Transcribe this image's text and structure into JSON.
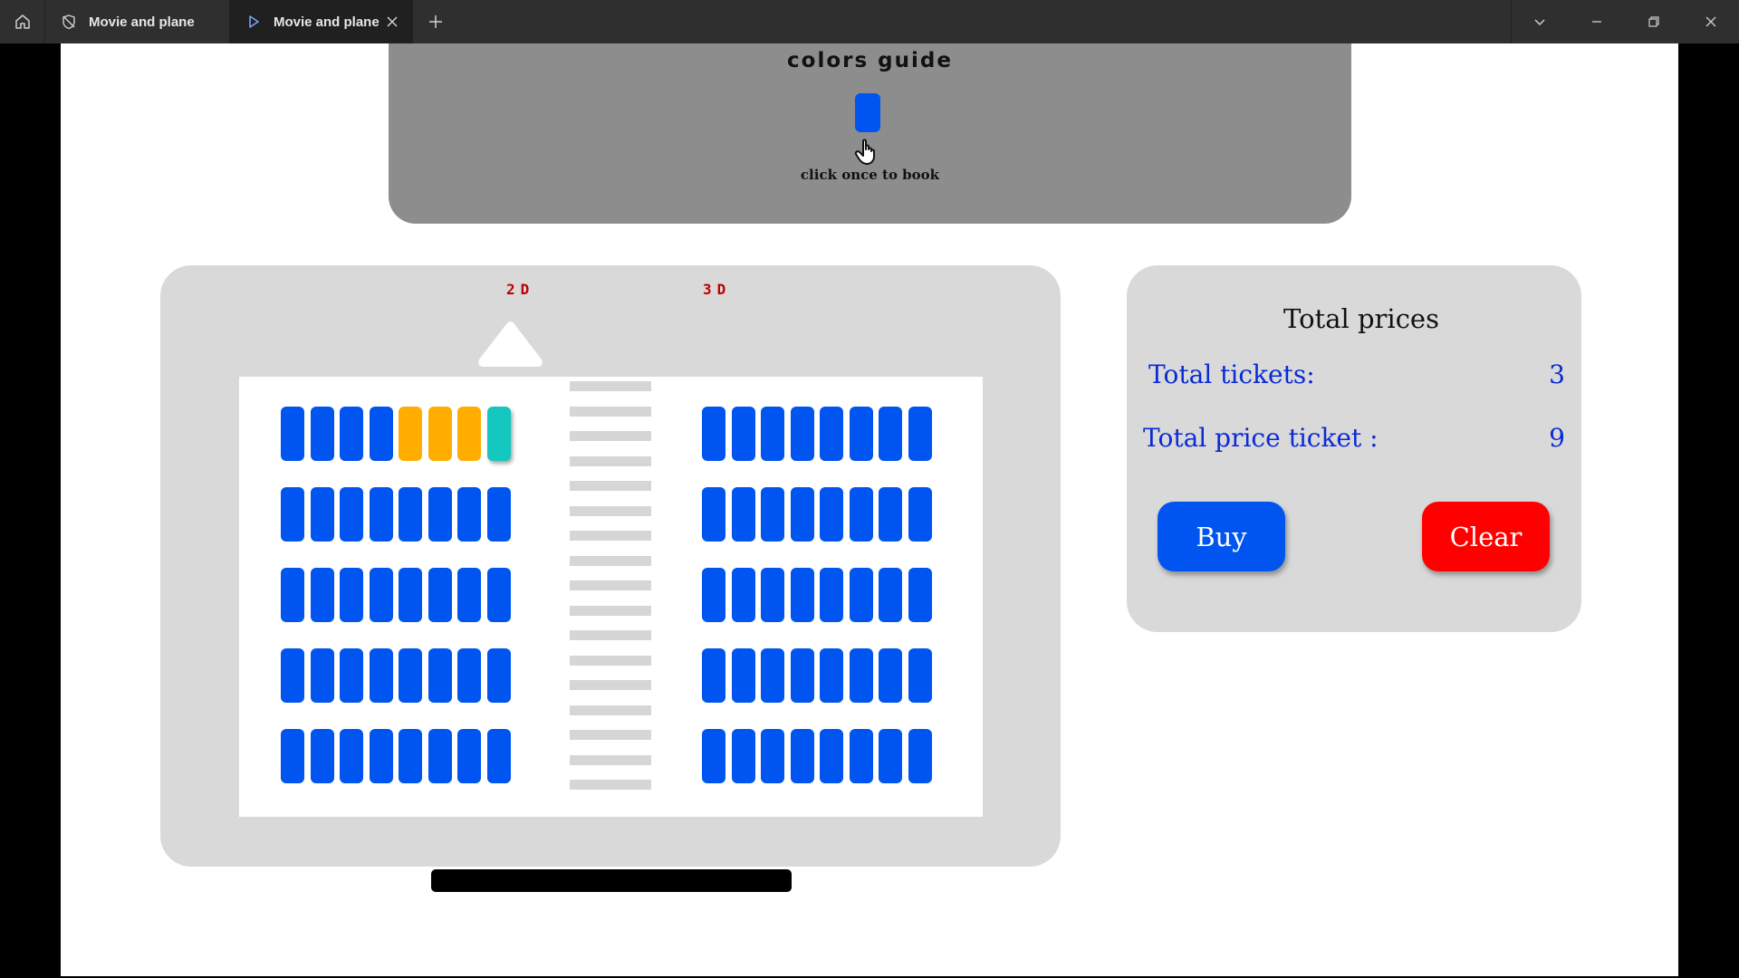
{
  "titlebar": {
    "tabs": [
      {
        "label": "Movie and plane",
        "icon": "privacy-icon",
        "active": false
      },
      {
        "label": "Movie and plane",
        "icon": "play-icon",
        "active": true
      }
    ]
  },
  "guide": {
    "title": "colors guide",
    "caption": "click once to book"
  },
  "hall": {
    "label_2d": "2D",
    "label_3d": "3D",
    "left_block": [
      [
        "available",
        "available",
        "available",
        "available",
        "booked",
        "booked",
        "booked",
        "selected"
      ],
      [
        "available",
        "available",
        "available",
        "available",
        "available",
        "available",
        "available",
        "available"
      ],
      [
        "available",
        "available",
        "available",
        "available",
        "available",
        "available",
        "available",
        "available"
      ],
      [
        "available",
        "available",
        "available",
        "available",
        "available",
        "available",
        "available",
        "available"
      ],
      [
        "available",
        "available",
        "available",
        "available",
        "available",
        "available",
        "available",
        "available"
      ]
    ],
    "right_block": [
      [
        "available",
        "available",
        "available",
        "available",
        "available",
        "available",
        "available",
        "available"
      ],
      [
        "available",
        "available",
        "available",
        "available",
        "available",
        "available",
        "available",
        "available"
      ],
      [
        "available",
        "available",
        "available",
        "available",
        "available",
        "available",
        "available",
        "available"
      ],
      [
        "available",
        "available",
        "available",
        "available",
        "available",
        "available",
        "available",
        "available"
      ],
      [
        "available",
        "available",
        "available",
        "available",
        "available",
        "available",
        "available",
        "available"
      ]
    ],
    "aisle_lines": 17
  },
  "totals": {
    "title": "Total prices",
    "tickets_label": "Total tickets:",
    "tickets_value": "3",
    "price_label": "Total price ticket :",
    "price_value": "9",
    "buy_label": "Buy",
    "clear_label": "Clear"
  },
  "colors": {
    "available": "#0055f0",
    "booked": "#ffae00",
    "selected": "#14c7c0",
    "clear": "#ff0000",
    "total_text": "#0a2ad6"
  }
}
